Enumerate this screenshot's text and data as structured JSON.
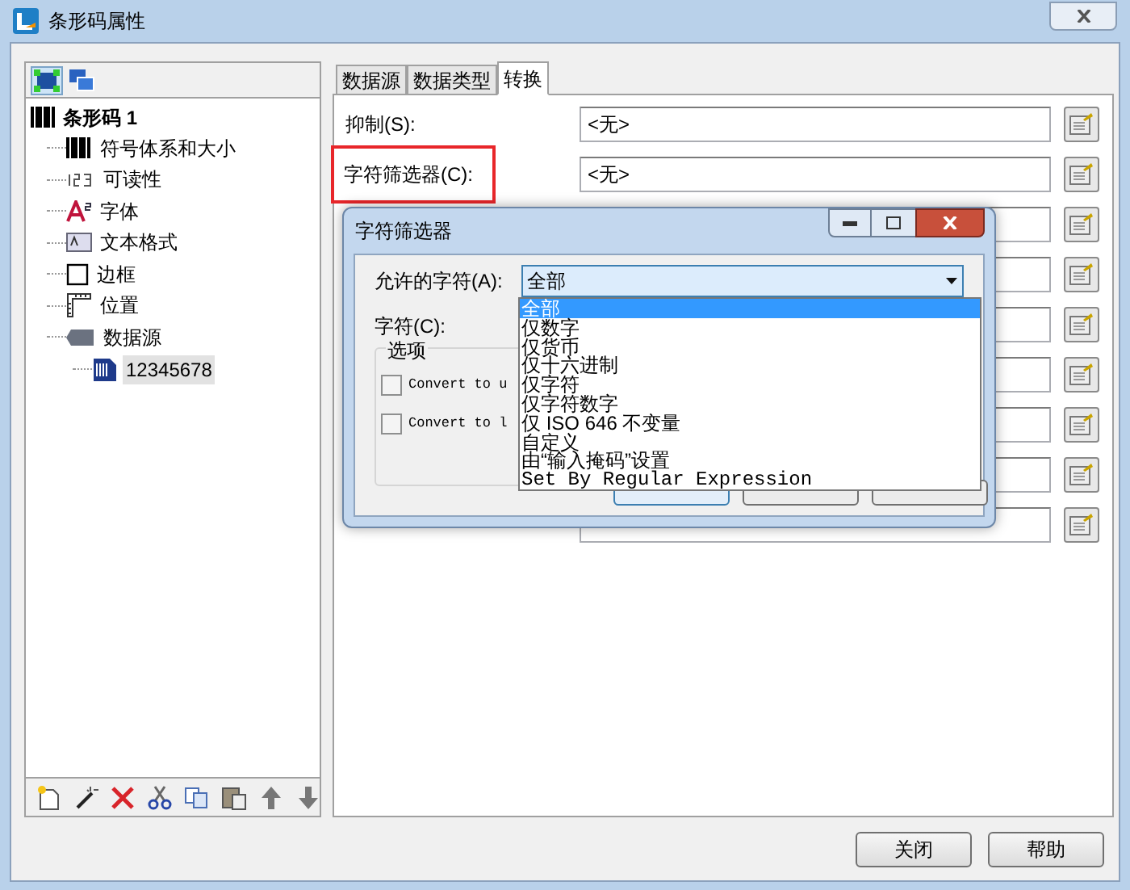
{
  "window": {
    "title": "条形码属性"
  },
  "tree": {
    "label": "条形码 1",
    "children": [
      {
        "label": "符号体系和大小",
        "selected": false
      },
      {
        "label": "可读性",
        "selected": false
      },
      {
        "label": "字体",
        "selected": false
      },
      {
        "label": "文本格式",
        "selected": false
      },
      {
        "label": "边框",
        "selected": false
      },
      {
        "label": "位置",
        "selected": false
      },
      {
        "label": "数据源",
        "selected": false,
        "children": [
          {
            "label": "12345678",
            "selected": true
          }
        ]
      }
    ]
  },
  "tabs": [
    {
      "label": "数据源",
      "selected": false
    },
    {
      "label": "数据类型",
      "selected": false
    },
    {
      "label": "转换",
      "selected": true
    }
  ],
  "rows": [
    {
      "label": "抑制(S):",
      "value": "<无>",
      "highlighted": false
    },
    {
      "label": "字符筛选器(C):",
      "value": "<无>",
      "highlighted": true
    },
    {},
    {},
    {},
    {},
    {},
    {},
    {}
  ],
  "buttons": [
    "关闭",
    "帮助"
  ],
  "dialog": {
    "title": "字符筛选器",
    "allowed_label": "允许的字符(A):",
    "allowed_value": "全部",
    "chars_label": "字符(C):",
    "group_title": "选项",
    "checkboxes": [
      {
        "label": "Convert to u",
        "checked": false
      },
      {
        "label": "Convert to l",
        "checked": false
      }
    ],
    "dropdown": [
      {
        "label": "全部",
        "selected": true
      },
      {
        "label": "仅数字",
        "selected": false
      },
      {
        "label": "仅货币",
        "selected": false
      },
      {
        "label": "仅十六进制",
        "selected": false
      },
      {
        "label": "仅字符",
        "selected": false
      },
      {
        "label": "仅字符数字",
        "selected": false
      },
      {
        "label": "仅 ISO 646 不变量",
        "selected": false
      },
      {
        "label": "自定义",
        "selected": false
      },
      {
        "label": "由“输入掩码”设置",
        "selected": false
      },
      {
        "label": "Set By Regular Expression",
        "selected": false
      }
    ]
  }
}
